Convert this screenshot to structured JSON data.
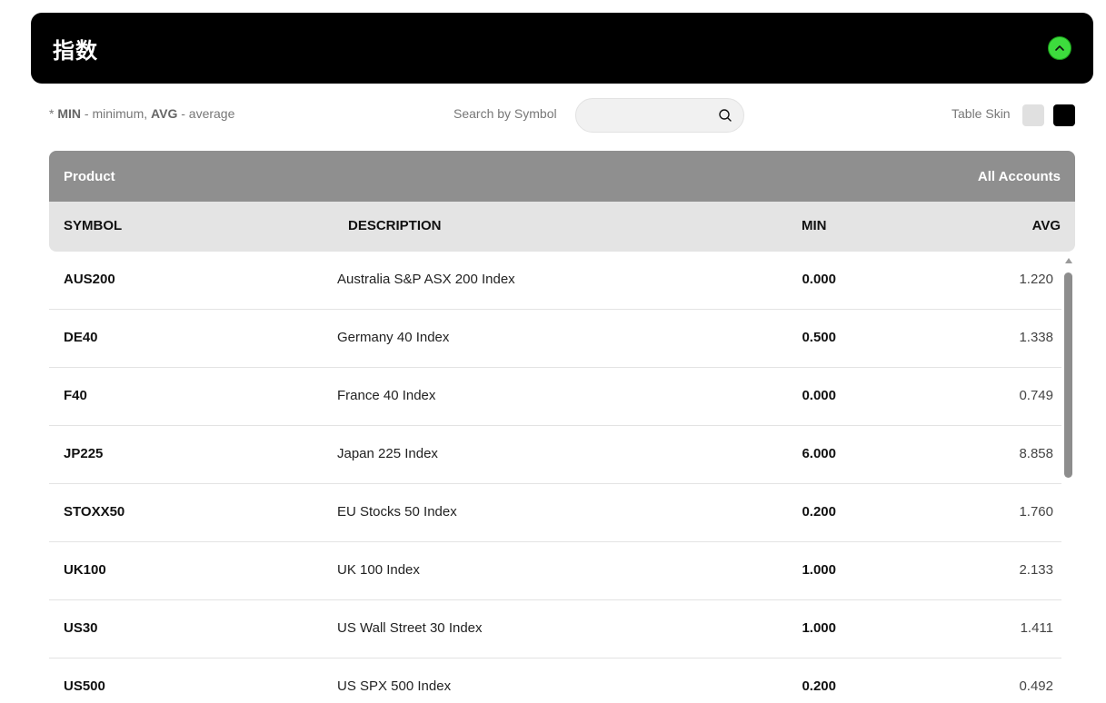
{
  "header": {
    "title": "指数"
  },
  "legend": {
    "prefix": "*",
    "min_key": "MIN",
    "min_text": "- minimum,",
    "avg_key": "AVG",
    "avg_text": "- average"
  },
  "search": {
    "label": "Search by Symbol",
    "value": "",
    "placeholder": ""
  },
  "skin": {
    "label": "Table Skin",
    "options": [
      "light",
      "dark"
    ],
    "light_color": "#e0e0e0",
    "dark_color": "#000000"
  },
  "table": {
    "group_left": "Product",
    "group_right": "All Accounts",
    "columns": {
      "symbol": "SYMBOL",
      "description": "DESCRIPTION",
      "min": "MIN",
      "avg": "AVG"
    },
    "rows": [
      {
        "symbol": "AUS200",
        "description": "Australia S&P ASX 200 Index",
        "min": "0.000",
        "avg": "1.220"
      },
      {
        "symbol": "DE40",
        "description": "Germany 40 Index",
        "min": "0.500",
        "avg": "1.338"
      },
      {
        "symbol": "F40",
        "description": "France 40 Index",
        "min": "0.000",
        "avg": "0.749"
      },
      {
        "symbol": "JP225",
        "description": "Japan 225 Index",
        "min": "6.000",
        "avg": "8.858"
      },
      {
        "symbol": "STOXX50",
        "description": "EU Stocks 50 Index",
        "min": "0.200",
        "avg": "1.760"
      },
      {
        "symbol": "UK100",
        "description": "UK 100 Index",
        "min": "1.000",
        "avg": "2.133"
      },
      {
        "symbol": "US30",
        "description": "US Wall Street 30 Index",
        "min": "1.000",
        "avg": "1.411"
      },
      {
        "symbol": "US500",
        "description": "US SPX 500 Index",
        "min": "0.200",
        "avg": "0.492"
      }
    ]
  },
  "colors": {
    "accent": "#3ddc3d",
    "header_bg": "#000000",
    "group_bg": "#8f8f8f",
    "col_header_bg": "#e4e4e4"
  },
  "icons": {
    "collapse": "chevron-up-icon",
    "search": "search-icon"
  }
}
